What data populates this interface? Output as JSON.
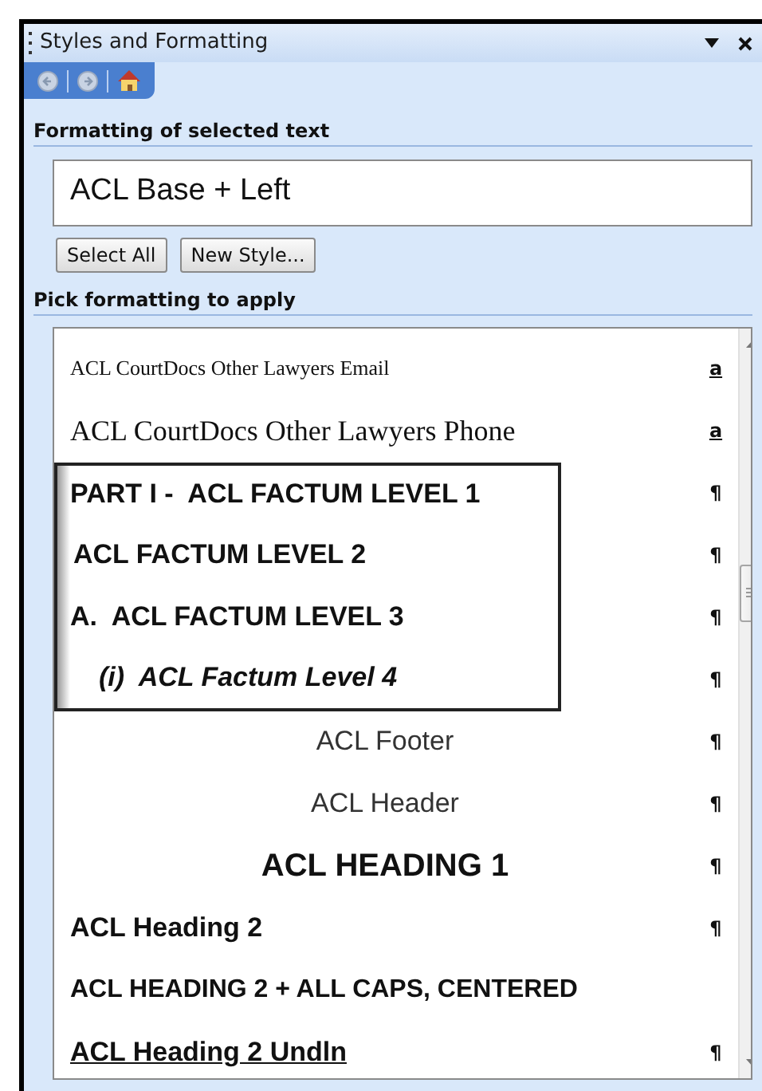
{
  "pane": {
    "title": "Styles and Formatting"
  },
  "selected_text": {
    "label": "Formatting of selected text",
    "value": "ACL Base + Left"
  },
  "buttons": [
    "Select All",
    "New Style..."
  ],
  "pick": {
    "label": "Pick formatting to apply"
  },
  "styles": [
    {
      "name": "ACL CourtDocs Other Lawyers Email",
      "kind": "serif-small",
      "mark": "a",
      "framed": false
    },
    {
      "name": "ACL CourtDocs Other Lawyers Phone",
      "kind": "serif",
      "mark": "a",
      "framed": false
    },
    {
      "name": "PART I -  ACL FACTUM LEVEL 1",
      "kind": "bold",
      "mark": "¶",
      "framed": true
    },
    {
      "name": "ACL FACTUM LEVEL 2",
      "kind": "bold-indent",
      "mark": "¶",
      "framed": true
    },
    {
      "name": "A.  ACL FACTUM LEVEL 3",
      "kind": "bold",
      "mark": "¶",
      "framed": true
    },
    {
      "name": "(i)  ACL Factum Level 4",
      "kind": "bold-italic",
      "mark": "¶",
      "framed": true
    },
    {
      "name": "ACL Footer",
      "kind": "center",
      "mark": "¶",
      "framed": false
    },
    {
      "name": "ACL Header",
      "kind": "center",
      "mark": "¶",
      "framed": false
    },
    {
      "name": "ACL HEADING 1",
      "kind": "bold-center-large",
      "mark": "¶",
      "framed": false
    },
    {
      "name": "ACL Heading 2",
      "kind": "bold",
      "mark": "¶",
      "framed": false
    },
    {
      "name": "ACL HEADING 2 + ALL CAPS, CENTERED",
      "kind": "bold",
      "framed": false
    },
    {
      "name": "ACL Heading 2 Undln",
      "kind": "bold-underline",
      "mark": "¶",
      "framed": false
    }
  ]
}
